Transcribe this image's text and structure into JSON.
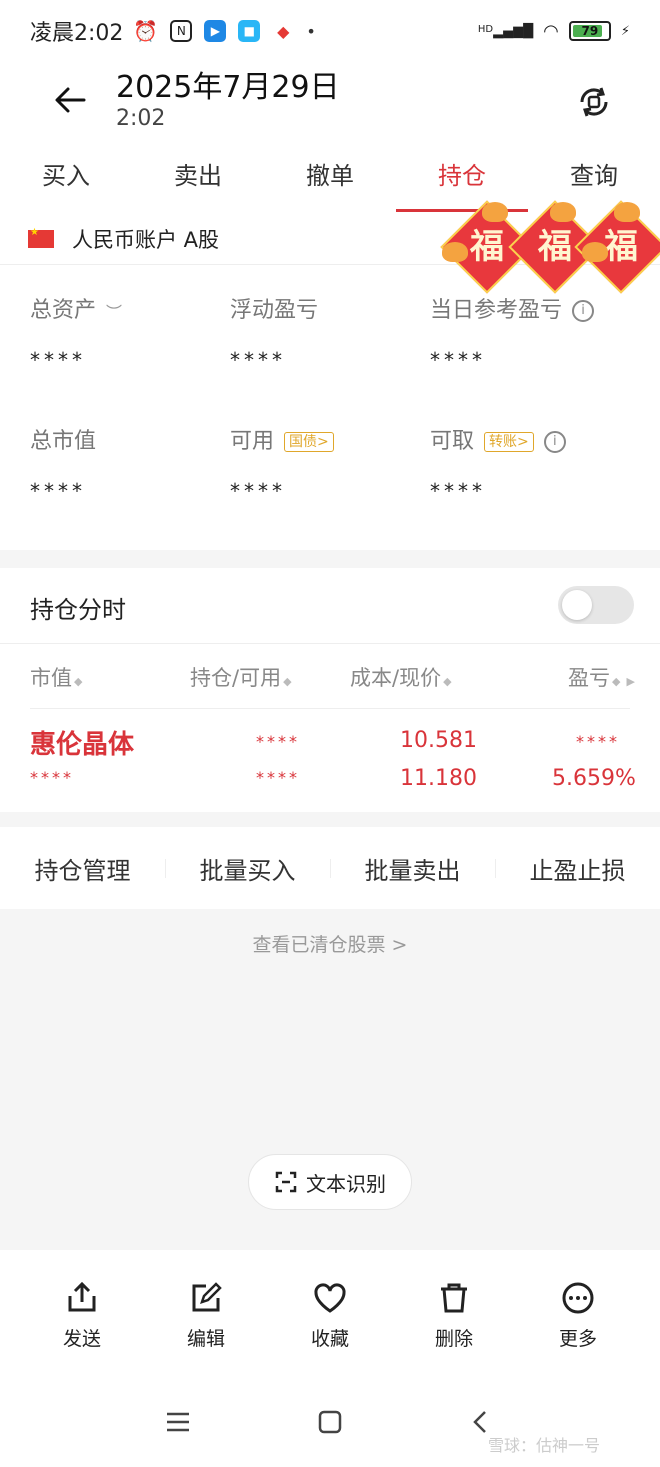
{
  "status_bar": {
    "time": "凌晨2:02",
    "battery": "79",
    "network": "HD"
  },
  "header": {
    "date": "2025年7月29日",
    "time": "2:02"
  },
  "tabs": [
    {
      "label": "买入"
    },
    {
      "label": "卖出"
    },
    {
      "label": "撤单"
    },
    {
      "label": "持仓",
      "active": true
    },
    {
      "label": "查询"
    }
  ],
  "account": {
    "label": "人民币账户 A股",
    "fu_char": "福",
    "metrics": [
      {
        "label": "总资产",
        "value": "****"
      },
      {
        "label": "浮动盈亏",
        "value": "****"
      },
      {
        "label": "当日参考盈亏",
        "value": "****"
      },
      {
        "label": "总市值",
        "value": "****"
      },
      {
        "label": "可用",
        "value": "****",
        "tag": "国债>"
      },
      {
        "label": "可取",
        "value": "****",
        "tag": "转账>"
      }
    ]
  },
  "positions": {
    "title": "持仓分时",
    "toggle_on": false,
    "columns": [
      "市值",
      "持仓/可用",
      "成本/现价",
      "盈亏"
    ],
    "rows": [
      {
        "name": "惠伦晶体",
        "market_value": "****",
        "holding": "****",
        "available": "****",
        "cost": "10.581",
        "price": "11.180",
        "pnl": "****",
        "pnl_pct": "5.659%"
      }
    ]
  },
  "actions": [
    "持仓管理",
    "批量买入",
    "批量卖出",
    "止盈止损"
  ],
  "cleared_link": "查看已清仓股票 >",
  "ocr_button": "文本识别",
  "toolbar": [
    {
      "label": "发送",
      "icon": "share-icon"
    },
    {
      "label": "编辑",
      "icon": "edit-icon"
    },
    {
      "label": "收藏",
      "icon": "heart-icon"
    },
    {
      "label": "删除",
      "icon": "trash-icon"
    },
    {
      "label": "更多",
      "icon": "more-icon"
    }
  ],
  "watermark": "雪球：估神一号",
  "colors": {
    "accent": "#d9343a",
    "tag": "#e0a72b"
  }
}
